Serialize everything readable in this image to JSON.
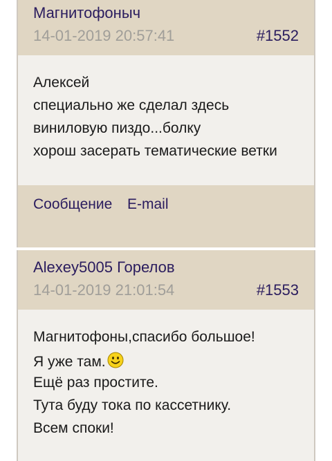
{
  "posts": [
    {
      "author": "Магнитофоныч",
      "date": "14-01-2019 20:57:41",
      "number": "#1552",
      "lines": [
        "Алексей",
        "специально же сделал здесь",
        "виниловую пиздо...болку",
        "хорош засерать тематические ветки"
      ],
      "footer": {
        "message_label": "Сообщение",
        "email_label": "E-mail"
      }
    },
    {
      "author": "Alexey5005 Горелов",
      "date": "14-01-2019 21:01:54",
      "number": "#1553",
      "lines": [
        "Магнитофоны,спасибо большое!",
        "Я уже там.",
        "Ещё раз простите.",
        "Тута буду тока по кассетнику.",
        "Всем споки!"
      ],
      "smiley_icon": "smiley-face-icon"
    }
  ],
  "colors": {
    "header_bg": "#e0d6c3",
    "body_bg": "#f2f0ec",
    "link": "#2a1c5e",
    "date": "#a09e99"
  }
}
